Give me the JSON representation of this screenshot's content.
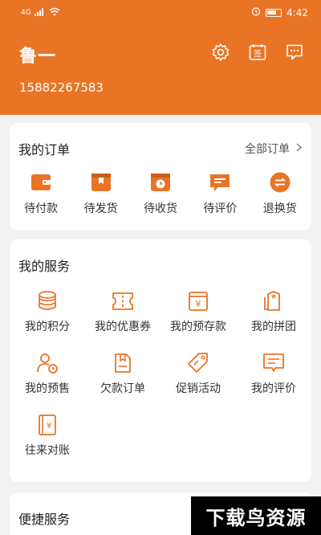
{
  "status_bar": {
    "network": "4G",
    "time": "4:42"
  },
  "header": {
    "user_name": "鲁一",
    "phone": "15882267583"
  },
  "orders": {
    "title": "我的订单",
    "all_link": "全部订单",
    "items": [
      {
        "label": "待付款",
        "icon": "wallet-icon"
      },
      {
        "label": "待发货",
        "icon": "box-icon"
      },
      {
        "label": "待收货",
        "icon": "delivery-clock-icon"
      },
      {
        "label": "待评价",
        "icon": "comment-icon"
      },
      {
        "label": "退换货",
        "icon": "exchange-icon"
      }
    ]
  },
  "services": {
    "title": "我的服务",
    "items": [
      {
        "label": "我的积分",
        "icon": "coins-icon"
      },
      {
        "label": "我的优惠券",
        "icon": "coupon-icon"
      },
      {
        "label": "我的预存款",
        "icon": "deposit-icon"
      },
      {
        "label": "我的拼团",
        "icon": "group-tag-icon"
      },
      {
        "label": "我的预售",
        "icon": "presale-user-icon"
      },
      {
        "label": "欠款订单",
        "icon": "debt-order-icon"
      },
      {
        "label": "促销活动",
        "icon": "promo-tag-icon"
      },
      {
        "label": "我的评价",
        "icon": "review-icon"
      },
      {
        "label": "往来对账",
        "icon": "ledger-icon"
      }
    ]
  },
  "quick": {
    "title": "便捷服务"
  },
  "watermark": "下载鸟资源",
  "colors": {
    "accent": "#e97426",
    "background": "#f2f2f2"
  }
}
